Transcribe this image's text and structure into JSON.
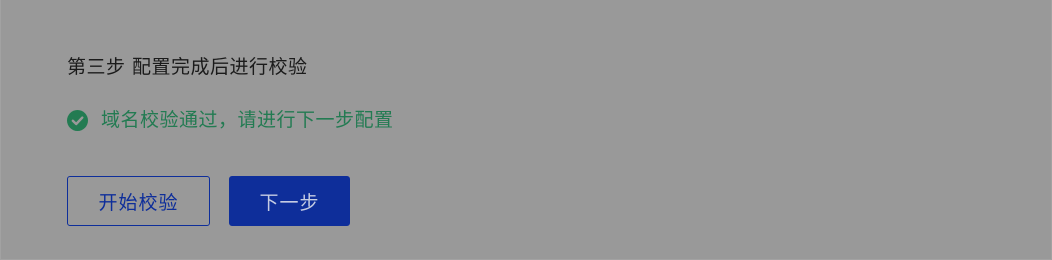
{
  "step": {
    "title": "第三步 配置完成后进行校验"
  },
  "status": {
    "icon": "check-circle-icon",
    "text": "域名校验通过，请进行下一步配置",
    "color": "#237b52"
  },
  "actions": {
    "verify_label": "开始校验",
    "next_label": "下一步",
    "outline_text_color": "#0e2e9a",
    "primary_bg_color": "#0e2e9a",
    "primary_text_color": "#c5cce3"
  }
}
